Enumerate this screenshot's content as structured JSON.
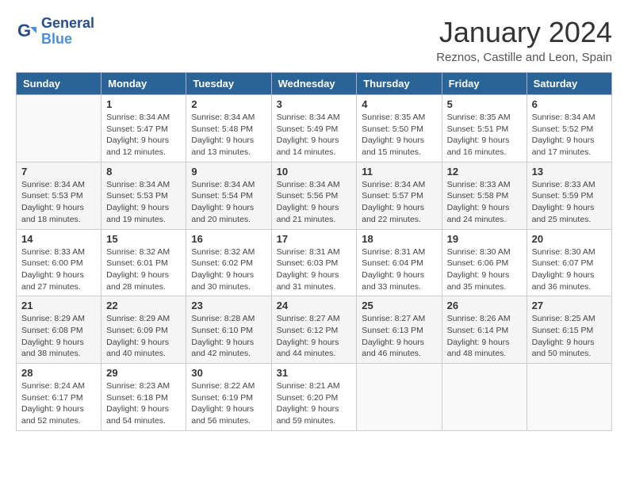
{
  "header": {
    "logo_line1": "General",
    "logo_line2": "Blue",
    "month": "January 2024",
    "location": "Reznos, Castille and Leon, Spain"
  },
  "weekdays": [
    "Sunday",
    "Monday",
    "Tuesday",
    "Wednesday",
    "Thursday",
    "Friday",
    "Saturday"
  ],
  "weeks": [
    [
      {
        "day": "",
        "info": ""
      },
      {
        "day": "1",
        "info": "Sunrise: 8:34 AM\nSunset: 5:47 PM\nDaylight: 9 hours\nand 12 minutes."
      },
      {
        "day": "2",
        "info": "Sunrise: 8:34 AM\nSunset: 5:48 PM\nDaylight: 9 hours\nand 13 minutes."
      },
      {
        "day": "3",
        "info": "Sunrise: 8:34 AM\nSunset: 5:49 PM\nDaylight: 9 hours\nand 14 minutes."
      },
      {
        "day": "4",
        "info": "Sunrise: 8:35 AM\nSunset: 5:50 PM\nDaylight: 9 hours\nand 15 minutes."
      },
      {
        "day": "5",
        "info": "Sunrise: 8:35 AM\nSunset: 5:51 PM\nDaylight: 9 hours\nand 16 minutes."
      },
      {
        "day": "6",
        "info": "Sunrise: 8:34 AM\nSunset: 5:52 PM\nDaylight: 9 hours\nand 17 minutes."
      }
    ],
    [
      {
        "day": "7",
        "info": "Sunrise: 8:34 AM\nSunset: 5:53 PM\nDaylight: 9 hours\nand 18 minutes."
      },
      {
        "day": "8",
        "info": "Sunrise: 8:34 AM\nSunset: 5:53 PM\nDaylight: 9 hours\nand 19 minutes."
      },
      {
        "day": "9",
        "info": "Sunrise: 8:34 AM\nSunset: 5:54 PM\nDaylight: 9 hours\nand 20 minutes."
      },
      {
        "day": "10",
        "info": "Sunrise: 8:34 AM\nSunset: 5:56 PM\nDaylight: 9 hours\nand 21 minutes."
      },
      {
        "day": "11",
        "info": "Sunrise: 8:34 AM\nSunset: 5:57 PM\nDaylight: 9 hours\nand 22 minutes."
      },
      {
        "day": "12",
        "info": "Sunrise: 8:33 AM\nSunset: 5:58 PM\nDaylight: 9 hours\nand 24 minutes."
      },
      {
        "day": "13",
        "info": "Sunrise: 8:33 AM\nSunset: 5:59 PM\nDaylight: 9 hours\nand 25 minutes."
      }
    ],
    [
      {
        "day": "14",
        "info": "Sunrise: 8:33 AM\nSunset: 6:00 PM\nDaylight: 9 hours\nand 27 minutes."
      },
      {
        "day": "15",
        "info": "Sunrise: 8:32 AM\nSunset: 6:01 PM\nDaylight: 9 hours\nand 28 minutes."
      },
      {
        "day": "16",
        "info": "Sunrise: 8:32 AM\nSunset: 6:02 PM\nDaylight: 9 hours\nand 30 minutes."
      },
      {
        "day": "17",
        "info": "Sunrise: 8:31 AM\nSunset: 6:03 PM\nDaylight: 9 hours\nand 31 minutes."
      },
      {
        "day": "18",
        "info": "Sunrise: 8:31 AM\nSunset: 6:04 PM\nDaylight: 9 hours\nand 33 minutes."
      },
      {
        "day": "19",
        "info": "Sunrise: 8:30 AM\nSunset: 6:06 PM\nDaylight: 9 hours\nand 35 minutes."
      },
      {
        "day": "20",
        "info": "Sunrise: 8:30 AM\nSunset: 6:07 PM\nDaylight: 9 hours\nand 36 minutes."
      }
    ],
    [
      {
        "day": "21",
        "info": "Sunrise: 8:29 AM\nSunset: 6:08 PM\nDaylight: 9 hours\nand 38 minutes."
      },
      {
        "day": "22",
        "info": "Sunrise: 8:29 AM\nSunset: 6:09 PM\nDaylight: 9 hours\nand 40 minutes."
      },
      {
        "day": "23",
        "info": "Sunrise: 8:28 AM\nSunset: 6:10 PM\nDaylight: 9 hours\nand 42 minutes."
      },
      {
        "day": "24",
        "info": "Sunrise: 8:27 AM\nSunset: 6:12 PM\nDaylight: 9 hours\nand 44 minutes."
      },
      {
        "day": "25",
        "info": "Sunrise: 8:27 AM\nSunset: 6:13 PM\nDaylight: 9 hours\nand 46 minutes."
      },
      {
        "day": "26",
        "info": "Sunrise: 8:26 AM\nSunset: 6:14 PM\nDaylight: 9 hours\nand 48 minutes."
      },
      {
        "day": "27",
        "info": "Sunrise: 8:25 AM\nSunset: 6:15 PM\nDaylight: 9 hours\nand 50 minutes."
      }
    ],
    [
      {
        "day": "28",
        "info": "Sunrise: 8:24 AM\nSunset: 6:17 PM\nDaylight: 9 hours\nand 52 minutes."
      },
      {
        "day": "29",
        "info": "Sunrise: 8:23 AM\nSunset: 6:18 PM\nDaylight: 9 hours\nand 54 minutes."
      },
      {
        "day": "30",
        "info": "Sunrise: 8:22 AM\nSunset: 6:19 PM\nDaylight: 9 hours\nand 56 minutes."
      },
      {
        "day": "31",
        "info": "Sunrise: 8:21 AM\nSunset: 6:20 PM\nDaylight: 9 hours\nand 59 minutes."
      },
      {
        "day": "",
        "info": ""
      },
      {
        "day": "",
        "info": ""
      },
      {
        "day": "",
        "info": ""
      }
    ]
  ]
}
